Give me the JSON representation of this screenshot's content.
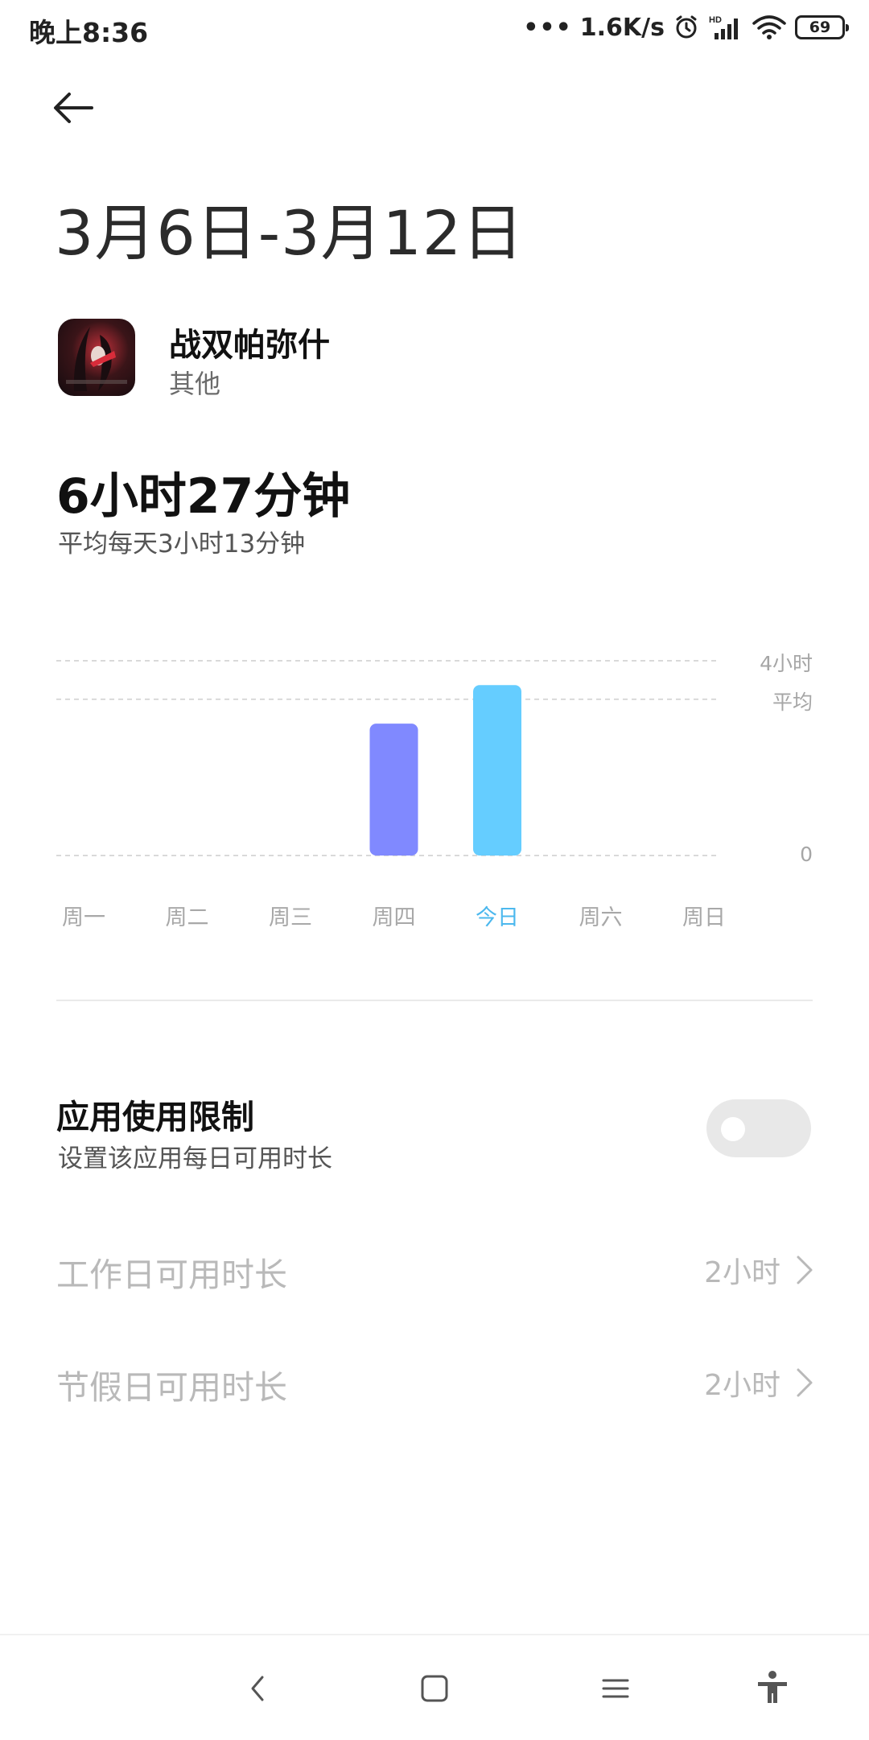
{
  "status_bar": {
    "time": "晚上8:36",
    "dots": "•••",
    "speed": "1.6K/s",
    "battery": "69",
    "icons": [
      "alarm-icon",
      "hd-signal-icon",
      "wifi-icon",
      "battery-icon"
    ]
  },
  "header": {
    "back_icon": "back-arrow-icon",
    "title": "3月6日-3月12日"
  },
  "app": {
    "name": "战双帕弥什",
    "category": "其他"
  },
  "usage": {
    "total": "6小时27分钟",
    "average": "平均每天3小时13分钟"
  },
  "chart_data": {
    "type": "bar",
    "categories": [
      "周一",
      "周二",
      "周三",
      "周四",
      "今日",
      "周六",
      "周日"
    ],
    "values": [
      0,
      0,
      0,
      3.25,
      4.2,
      0,
      0
    ],
    "highlight": "今日",
    "reference_lines": [
      {
        "label": "4小时",
        "value": 4.8
      },
      {
        "label": "平均",
        "value": 3.85
      },
      {
        "label": "0",
        "value": 0
      }
    ],
    "bar_colors": {
      "past": "#8089ff",
      "today": "#65cdff"
    },
    "ylim": [
      0,
      4.8
    ],
    "grid": "dashed"
  },
  "limit": {
    "title": "应用使用限制",
    "subtitle": "设置该应用每日可用时长",
    "toggle_on": false
  },
  "rows": [
    {
      "label": "工作日可用时长",
      "value": "2小时"
    },
    {
      "label": "节假日可用时长",
      "value": "2小时"
    }
  ],
  "nav": {
    "icons": [
      "nav-back-icon",
      "nav-home-icon",
      "nav-menu-icon",
      "accessibility-icon"
    ]
  },
  "colors": {
    "today_accent": "#4cb8ee",
    "bar_past": "#8089ff",
    "bar_today": "#65cdff"
  }
}
